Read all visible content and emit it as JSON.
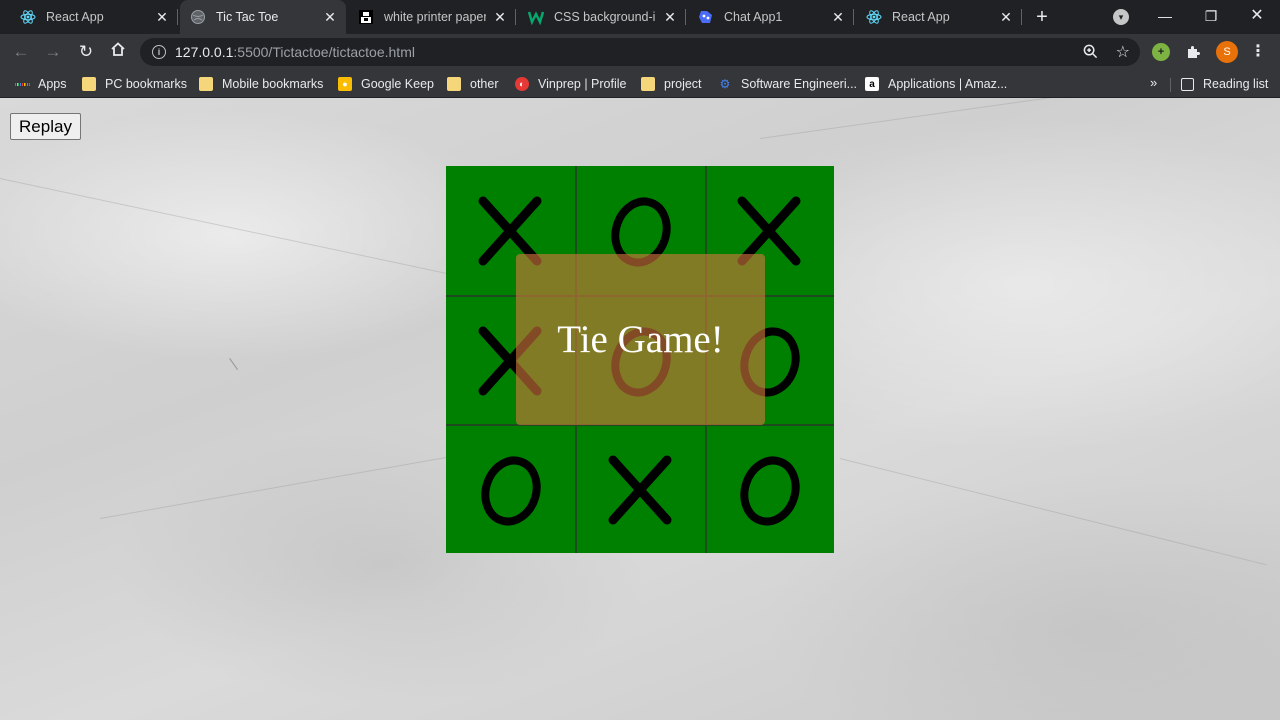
{
  "browser": {
    "tabs": [
      {
        "title": "React App",
        "icon": "react-icon",
        "active": false
      },
      {
        "title": "Tic Tac Toe",
        "icon": "globe-icon",
        "active": true
      },
      {
        "title": "white printer paper",
        "icon": "unsplash-icon",
        "active": false
      },
      {
        "title": "CSS background-im",
        "icon": "w3schools-icon",
        "active": false
      },
      {
        "title": "Chat App1",
        "icon": "chat-icon",
        "active": false
      },
      {
        "title": "React App",
        "icon": "react-icon",
        "active": false
      }
    ],
    "url_host": "127.0.0.1",
    "url_rest": ":5500/Tictactoe/tictactoe.html",
    "profile_initial": "S",
    "bookmarks": [
      {
        "label": "Apps",
        "icon": "apps-grid-icon"
      },
      {
        "label": "PC bookmarks",
        "icon": "folder-icon"
      },
      {
        "label": "Mobile bookmarks",
        "icon": "folder-icon"
      },
      {
        "label": "Google Keep",
        "icon": "keep-icon"
      },
      {
        "label": "other",
        "icon": "folder-icon"
      },
      {
        "label": "Vinprep | Profile",
        "icon": "vinprep-icon"
      },
      {
        "label": "project",
        "icon": "folder-icon"
      },
      {
        "label": "Software Engineeri...",
        "icon": "engineering-icon"
      },
      {
        "label": "Applications | Amaz...",
        "icon": "amazon-icon"
      }
    ],
    "overflow_label": "»",
    "reading_list_label": "Reading list"
  },
  "game": {
    "replay_label": "Replay",
    "board": [
      "X",
      "O",
      "X",
      "X",
      "O",
      "O",
      "O",
      "X",
      "O"
    ],
    "result_message": "Tie Game!",
    "colors": {
      "board": "#008000",
      "overlay": "rgba(210,120,60,0.62)",
      "mark": "#000000"
    }
  }
}
